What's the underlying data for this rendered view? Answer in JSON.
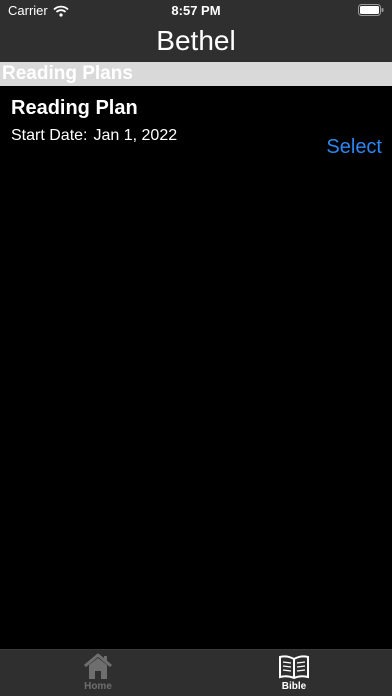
{
  "status_bar": {
    "carrier": "Carrier",
    "time": "8:57 PM"
  },
  "nav": {
    "title": "Bethel"
  },
  "section": {
    "header": "Reading Plans"
  },
  "plan": {
    "title": "Reading Plan",
    "start_label": "Start Date:",
    "start_value": "Jan 1, 2022",
    "select_label": "Select"
  },
  "tabs": [
    {
      "label": "Home",
      "icon": "home-icon",
      "selected": false
    },
    {
      "label": "Bible",
      "icon": "book-icon",
      "selected": true
    }
  ],
  "colors": {
    "background": "#000000",
    "bar": "#2f2f2f",
    "section_header": "#d9d9d9",
    "accent": "#2b86f0",
    "tab_inactive": "#6e6e6e"
  }
}
